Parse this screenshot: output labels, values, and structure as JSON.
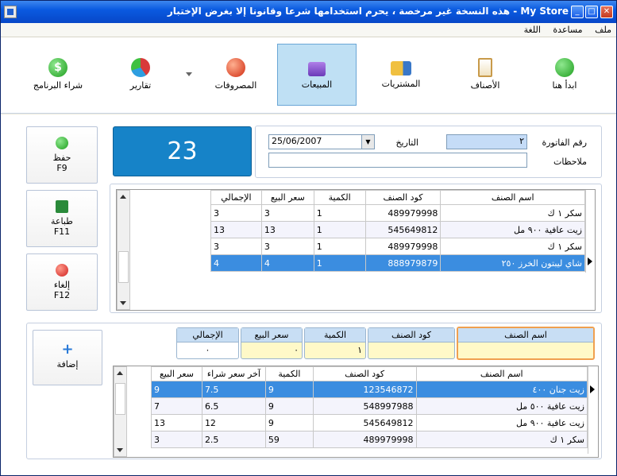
{
  "window": {
    "title": "My Store - هذه النسخة غير مرخصة ، يحرم استخدامها شرعا وقانونا إلا بغرض الإختبار"
  },
  "menu": [
    "ملف",
    "مساعدة",
    "اللغة"
  ],
  "toolbar": [
    {
      "label": "ابدأ هنا",
      "icon": "check-icon",
      "color": "#2eb82e"
    },
    {
      "label": "الأصناف",
      "icon": "clipboard-icon",
      "color": "#c89a4a"
    },
    {
      "label": "المشتريات",
      "icon": "truck-icon",
      "color": "#3a78c8"
    },
    {
      "label": "المبيعات",
      "icon": "cart-icon",
      "color": "#8a4ad0",
      "active": true
    },
    {
      "label": "المصروفات",
      "icon": "red-ball-icon",
      "color": "#e84a2a"
    },
    {
      "label": "تقارير",
      "icon": "pie-chart-icon",
      "color": "#d84040"
    },
    {
      "label": "شراء البرنامج",
      "icon": "dollar-icon",
      "color": "#2eb82e"
    }
  ],
  "side": {
    "save": {
      "label": "حفظ",
      "key": "F9"
    },
    "print": {
      "label": "طباعة",
      "key": "F11"
    },
    "cancel": {
      "label": "إلغاء",
      "key": "F12"
    },
    "add": {
      "label": "إضافة"
    }
  },
  "counter": "23",
  "form": {
    "invoice_label": "رقم الفاتورة",
    "invoice_value": "٢",
    "date_label": "التاريخ",
    "date_value": "25/06/2007",
    "notes_label": "ملاحظات",
    "notes_value": ""
  },
  "invoice_table": {
    "headers": [
      "اسم الصنف",
      "كود الصنف",
      "الكمية",
      "سعر البيع",
      "الإجمالي"
    ],
    "rows": [
      [
        "سكر ١ ك",
        "489979998",
        "1",
        "3",
        "3"
      ],
      [
        "زيت عافية ٩٠٠ مل",
        "545649812",
        "1",
        "13",
        "13"
      ],
      [
        "سكر ١ ك",
        "489979998",
        "1",
        "3",
        "3"
      ],
      [
        "شاي ليبتون الخرز ٢٥٠",
        "888979879",
        "1",
        "4",
        "4"
      ]
    ],
    "selected_row": 3
  },
  "entry": {
    "item_name": {
      "label": "اسم الصنف",
      "value": ""
    },
    "item_code": {
      "label": "كود الصنف",
      "value": ""
    },
    "qty": {
      "label": "الكمية",
      "value": "١"
    },
    "price": {
      "label": "سعر البيع",
      "value": "٠"
    },
    "total": {
      "label": "الإجمالي",
      "value": "٠"
    }
  },
  "items_table": {
    "headers": [
      "اسم الصنف",
      "كود الصنف",
      "الكمية",
      "آخر سعر شراء",
      "سعر البيع"
    ],
    "rows": [
      [
        "زيت جنان ٤٠٠",
        "123546872",
        "9",
        "7.5",
        "9"
      ],
      [
        "زيت عافية ٥٠٠ مل",
        "548997988",
        "9",
        "6.5",
        "7"
      ],
      [
        "زيت عافية ٩٠٠ مل",
        "545649812",
        "9",
        "12",
        "13"
      ],
      [
        "سكر ١ ك",
        "489979998",
        "59",
        "2.5",
        "3"
      ]
    ],
    "selected_row": 0
  }
}
